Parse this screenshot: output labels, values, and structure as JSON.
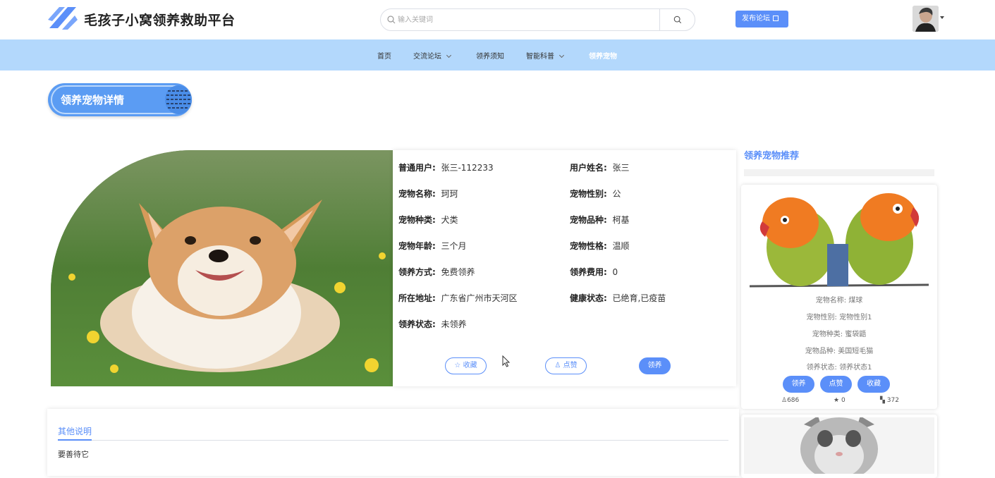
{
  "header": {
    "site_title": "毛孩子小窝领养救助平台",
    "search_placeholder": "输入关键词",
    "publish_label": "发布论坛"
  },
  "nav": {
    "items": [
      {
        "label": "首页"
      },
      {
        "label": "交流论坛"
      },
      {
        "label": "领养须知"
      },
      {
        "label": "智能科普"
      },
      {
        "label": "领养宠物"
      }
    ]
  },
  "section_title": "领养宠物详情",
  "detail": {
    "fields": [
      {
        "label": "普通用户:",
        "value": "张三-112233"
      },
      {
        "label": "用户姓名:",
        "value": "张三"
      },
      {
        "label": "宠物名称:",
        "value": "珂珂"
      },
      {
        "label": "宠物性别:",
        "value": "公"
      },
      {
        "label": "宠物种类:",
        "value": "犬类"
      },
      {
        "label": "宠物品种:",
        "value": "柯基"
      },
      {
        "label": "宠物年龄:",
        "value": "三个月"
      },
      {
        "label": "宠物性格:",
        "value": "温顺"
      },
      {
        "label": "领养方式:",
        "value": "免费领养"
      },
      {
        "label": "领养费用:",
        "value": "0"
      },
      {
        "label": "所在地址:",
        "value": "广东省广州市天河区"
      },
      {
        "label": "健康状态:",
        "value": "已绝育,已疫苗"
      },
      {
        "label": "领养状态:",
        "value": "未领养"
      }
    ],
    "collect_label": "收藏",
    "like_label": "点赞",
    "adopt_label": "领养"
  },
  "recommend": {
    "title": "领养宠物推荐",
    "card": {
      "name_line": "宠物名称:  煤球",
      "gender_line": "宠物性别:  宠物性别1",
      "type_line": "宠物种类:  蜜袋鼯",
      "breed_line": "宠物品种:  美国短毛猫",
      "status_line": "领养状态:  领养状态1",
      "adopt_label": "领养",
      "like_label": "点赞",
      "collect_label": "收藏",
      "likes": "686",
      "stars": "0",
      "views": "372"
    }
  },
  "other": {
    "tab_label": "其他说明",
    "text": "要善待它"
  },
  "colors": {
    "accent": "#5b8ff9",
    "nav_bg": "#b3d8fc"
  }
}
